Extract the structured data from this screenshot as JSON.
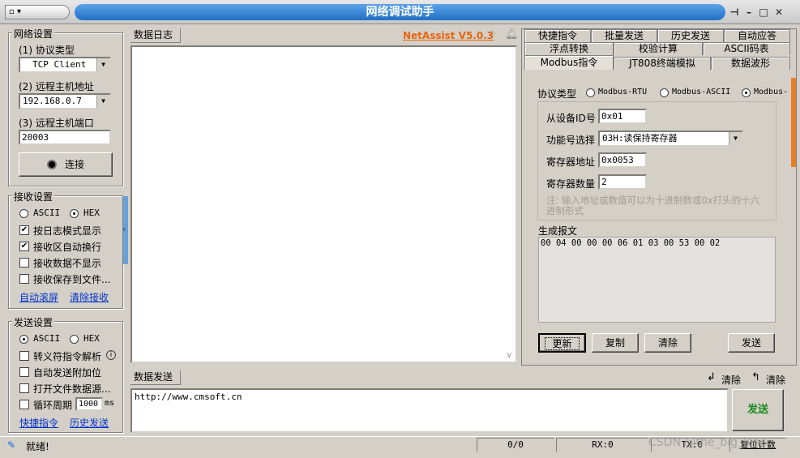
{
  "window": {
    "title": "网络调试助手",
    "sysmenu": "▫ ▾"
  },
  "network": {
    "group_title": "网络设置",
    "protocol_label": "(1) 协议类型",
    "protocol_value": "TCP Client",
    "host_label": "(2) 远程主机地址",
    "host_value": "192.168.0.7",
    "port_label": "(3) 远程主机端口",
    "port_value": "20003",
    "connect_label": "连接"
  },
  "receive": {
    "group_title": "接收设置",
    "ascii": "ASCII",
    "hex": "HEX",
    "opt1": "按日志模式显示",
    "opt2": "接收区自动换行",
    "opt3": "接收数据不显示",
    "opt4": "接收保存到文件...",
    "link1": "自动滚屏",
    "link2": "清除接收"
  },
  "send_settings": {
    "group_title": "发送设置",
    "ascii": "ASCII",
    "hex": "HEX",
    "opt1": "转义符指令解析",
    "opt2": "自动发送附加位",
    "opt3": "打开文件数据源...",
    "opt4": "循环周期",
    "period": "1000",
    "period_unit": "ms",
    "link1": "快捷指令",
    "link2": "历史发送"
  },
  "log": {
    "tab": "数据日志",
    "brand": "NetAssist V5.0.3"
  },
  "send": {
    "tab": "数据发送",
    "clear1": "清除",
    "clear2": "清除",
    "content": "http://www.cmsoft.cn",
    "send_button": "发送"
  },
  "right_tabs": {
    "row1": [
      "快捷指令",
      "批量发送",
      "历史发送",
      "自动应答"
    ],
    "row2": [
      "浮点转换",
      "校验计算",
      "ASCII码表"
    ],
    "row3": [
      "Modbus指令",
      "JT808终端模拟",
      "数据波形"
    ]
  },
  "modbus": {
    "protocol_label": "协议类型",
    "rtu": "Modbus-RTU",
    "ascii": "Modbus-ASCII",
    "tcp": "Modbus-",
    "slave_label": "从设备ID号",
    "slave_value": "0x01",
    "func_label": "功能号选择",
    "func_value": "03H:读保持寄存器",
    "addr_label": "寄存器地址",
    "addr_value": "0x0053",
    "count_label": "寄存器数量",
    "count_value": "2",
    "note": "注: 输入地址或数值可以为十进制数或0x打头的十六进制形式",
    "gen_label": "生成报文",
    "gen_value": "00 04 00 00 00 06 01 03 00 53 00 02",
    "btn_update": "更新",
    "btn_copy": "复制",
    "btn_clear": "清除",
    "btn_send": "发送"
  },
  "status": {
    "ready": "就绪!",
    "count": "0/0",
    "rx": "RX:0",
    "tx": "TX:0",
    "reset": "复位计数",
    "watermark": "CSDN @the_big_lear"
  }
}
